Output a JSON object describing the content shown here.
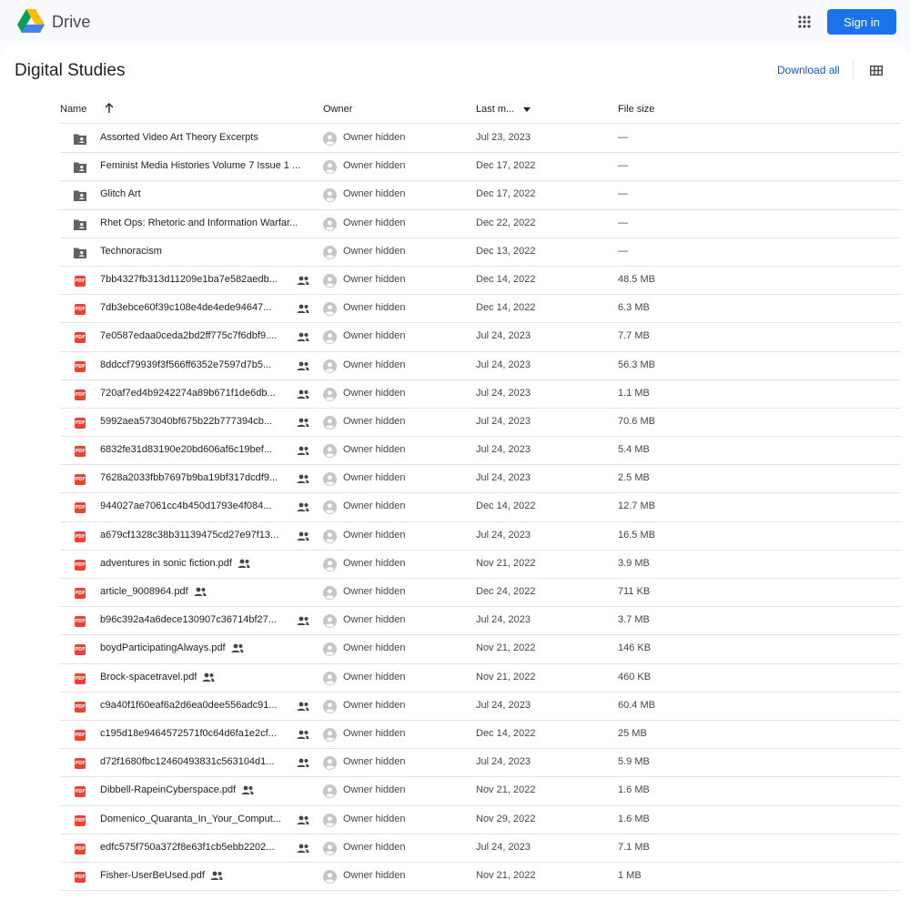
{
  "app": {
    "name": "Drive",
    "signin_label": "Sign in"
  },
  "colors": {
    "accent": "#1a73e8",
    "pdf": "#ea4335",
    "folder": "#5f6368"
  },
  "page": {
    "title": "Digital Studies",
    "download_all": "Download all"
  },
  "columns": {
    "name": "Name",
    "owner": "Owner",
    "modified": "Last m...",
    "size": "File size"
  },
  "pdf_badge": "PDF",
  "files": [
    {
      "type": "folder",
      "name": "Assorted Video Art Theory Excerpts",
      "owner": "Owner hidden",
      "modified": "Jul 23, 2023",
      "size": "—",
      "shared": false
    },
    {
      "type": "folder",
      "name": "Feminist Media Histories Volume 7 Issue 1 ...",
      "owner": "Owner hidden",
      "modified": "Dec 17, 2022",
      "size": "—",
      "shared": false
    },
    {
      "type": "folder",
      "name": "Glitch Art",
      "owner": "Owner hidden",
      "modified": "Dec 17, 2022",
      "size": "—",
      "shared": false
    },
    {
      "type": "folder",
      "name": "Rhet Ops: Rhetoric and Information Warfar...",
      "owner": "Owner hidden",
      "modified": "Dec 22, 2022",
      "size": "—",
      "shared": false
    },
    {
      "type": "folder",
      "name": "Technoracism",
      "owner": "Owner hidden",
      "modified": "Dec 13, 2022",
      "size": "—",
      "shared": false
    },
    {
      "type": "pdf",
      "name": "7bb4327fb313d11209e1ba7e582aedb...",
      "owner": "Owner hidden",
      "modified": "Dec 14, 2022",
      "size": "48.5 MB",
      "shared": true,
      "truncated": true
    },
    {
      "type": "pdf",
      "name": "7db3ebce60f39c108e4de4ede94647...",
      "owner": "Owner hidden",
      "modified": "Dec 14, 2022",
      "size": "6.3 MB",
      "shared": true,
      "truncated": true
    },
    {
      "type": "pdf",
      "name": "7e0587edaa0ceda2bd2ff775c7f6dbf9....",
      "owner": "Owner hidden",
      "modified": "Jul 24, 2023",
      "size": "7.7 MB",
      "shared": true,
      "truncated": true
    },
    {
      "type": "pdf",
      "name": "8ddccf79939f3f566ff6352e7597d7b5...",
      "owner": "Owner hidden",
      "modified": "Jul 24, 2023",
      "size": "56.3 MB",
      "shared": true,
      "truncated": true
    },
    {
      "type": "pdf",
      "name": "720af7ed4b9242274a89b671f1de6db...",
      "owner": "Owner hidden",
      "modified": "Jul 24, 2023",
      "size": "1.1 MB",
      "shared": true,
      "truncated": true
    },
    {
      "type": "pdf",
      "name": "5992aea573040bf675b22b777394cb...",
      "owner": "Owner hidden",
      "modified": "Jul 24, 2023",
      "size": "70.6 MB",
      "shared": true,
      "truncated": true
    },
    {
      "type": "pdf",
      "name": "6832fe31d83190e20bd606af6c19bef...",
      "owner": "Owner hidden",
      "modified": "Jul 24, 2023",
      "size": "5.4 MB",
      "shared": true,
      "truncated": true
    },
    {
      "type": "pdf",
      "name": "7628a2033fbb7697b9ba19bf317dcdf9...",
      "owner": "Owner hidden",
      "modified": "Jul 24, 2023",
      "size": "2.5 MB",
      "shared": true,
      "truncated": true
    },
    {
      "type": "pdf",
      "name": "944027ae7061cc4b450d1793e4f084...",
      "owner": "Owner hidden",
      "modified": "Dec 14, 2022",
      "size": "12.7 MB",
      "shared": true,
      "truncated": true
    },
    {
      "type": "pdf",
      "name": "a679cf1328c38b31139475cd27e97f13...",
      "owner": "Owner hidden",
      "modified": "Jul 24, 2023",
      "size": "16.5 MB",
      "shared": true,
      "truncated": true
    },
    {
      "type": "pdf",
      "name": "adventures in sonic fiction.pdf",
      "owner": "Owner hidden",
      "modified": "Nov 21, 2022",
      "size": "3.9 MB",
      "shared": true,
      "truncated": false
    },
    {
      "type": "pdf",
      "name": "article_9008964.pdf",
      "owner": "Owner hidden",
      "modified": "Dec 24, 2022",
      "size": "711 KB",
      "shared": true,
      "truncated": false
    },
    {
      "type": "pdf",
      "name": "b96c392a4a6dece130907c36714bf27...",
      "owner": "Owner hidden",
      "modified": "Jul 24, 2023",
      "size": "3.7 MB",
      "shared": true,
      "truncated": true
    },
    {
      "type": "pdf",
      "name": "boydParticipatingAlways.pdf",
      "owner": "Owner hidden",
      "modified": "Nov 21, 2022",
      "size": "146 KB",
      "shared": true,
      "truncated": false
    },
    {
      "type": "pdf",
      "name": "Brock-spacetravel.pdf",
      "owner": "Owner hidden",
      "modified": "Nov 21, 2022",
      "size": "460 KB",
      "shared": true,
      "truncated": false
    },
    {
      "type": "pdf",
      "name": "c9a40f1f60eaf6a2d6ea0dee556adc91...",
      "owner": "Owner hidden",
      "modified": "Jul 24, 2023",
      "size": "60.4 MB",
      "shared": true,
      "truncated": true
    },
    {
      "type": "pdf",
      "name": "c195d18e9464572571f0c64d6fa1e2cf...",
      "owner": "Owner hidden",
      "modified": "Dec 14, 2022",
      "size": "25 MB",
      "shared": true,
      "truncated": true
    },
    {
      "type": "pdf",
      "name": "d72f1680fbc12460493831c563104d1...",
      "owner": "Owner hidden",
      "modified": "Jul 24, 2023",
      "size": "5.9 MB",
      "shared": true,
      "truncated": true
    },
    {
      "type": "pdf",
      "name": "Dibbell-RapeinCyberspace.pdf",
      "owner": "Owner hidden",
      "modified": "Nov 21, 2022",
      "size": "1.6 MB",
      "shared": true,
      "truncated": false
    },
    {
      "type": "pdf",
      "name": "Domenico_Quaranta_In_Your_Comput...",
      "owner": "Owner hidden",
      "modified": "Nov 29, 2022",
      "size": "1.6 MB",
      "shared": true,
      "truncated": true
    },
    {
      "type": "pdf",
      "name": "edfc575f750a372f8e63f1cb5ebb2202...",
      "owner": "Owner hidden",
      "modified": "Jul 24, 2023",
      "size": "7.1 MB",
      "shared": true,
      "truncated": true
    },
    {
      "type": "pdf",
      "name": "Fisher-UserBeUsed.pdf",
      "owner": "Owner hidden",
      "modified": "Nov 21, 2022",
      "size": "1 MB",
      "shared": true,
      "truncated": false
    }
  ]
}
